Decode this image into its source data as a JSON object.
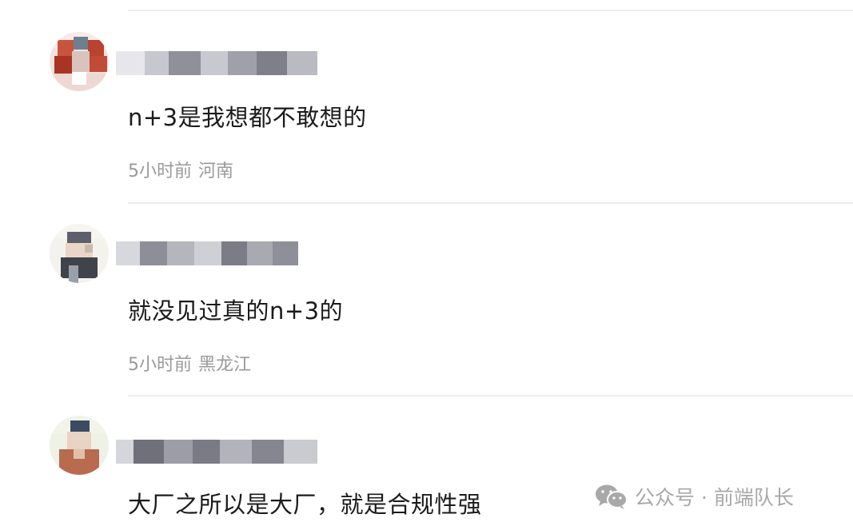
{
  "comments": [
    {
      "text": "n+3是我想都不敢想的",
      "time": "5小时前",
      "location": "河南"
    },
    {
      "text": "就没见过真的n+3的",
      "time": "5小时前",
      "location": "黑龙江"
    },
    {
      "text": "大厂之所以是大厂，就是合规性强"
    }
  ],
  "watermark": {
    "icon": "wechat-icon",
    "text": "公众号 · 前端队长"
  },
  "colors": {
    "text": "#1b1b1b",
    "meta": "#9a9a9a",
    "divider": "#ededed",
    "watermark": "#a8a8a8"
  }
}
